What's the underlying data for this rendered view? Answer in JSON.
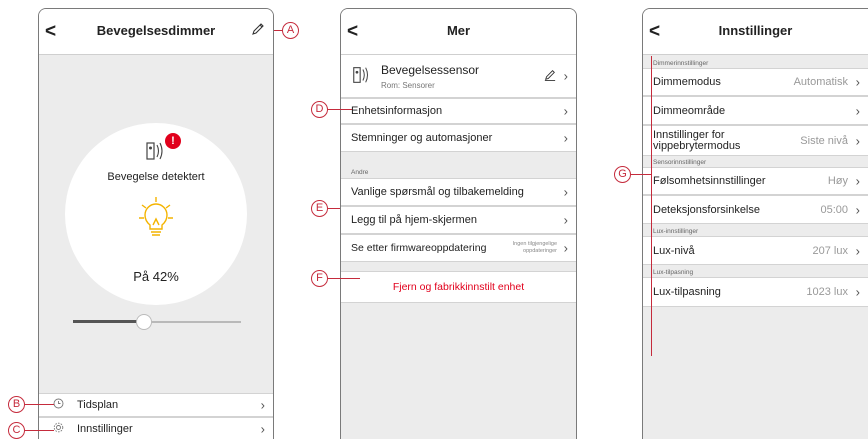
{
  "panel1": {
    "back": "<",
    "title": "Bevegelsesdimmer",
    "alert": "!",
    "detect_text": "Bevegelse detektert",
    "level_text": "På 42%",
    "level_fraction": 0.42,
    "rows": [
      {
        "label": "Tidsplan",
        "icon": "clock-icon"
      },
      {
        "label": "Innstillinger",
        "icon": "gear-icon"
      }
    ]
  },
  "panel2": {
    "back": "<",
    "title": "Mer",
    "device_name": "Bevegelsessensor",
    "device_room": "Rom: Sensorer",
    "rows": [
      {
        "label": "Enhetsinformasjon"
      },
      {
        "label": "Stemninger og automasjoner"
      }
    ],
    "section_label": "Andre",
    "rows2": [
      {
        "label": "Vanlige spørsmål og tilbakemelding"
      },
      {
        "label": "Legg til på hjem-skjermen"
      }
    ],
    "firmware_label": "Se etter firmwareoppdatering",
    "firmware_status_line1": "Ingen tilgjengelige",
    "firmware_status_line2": "oppdateringer",
    "remove_label": "Fjern og fabrikkinnstilt enhet"
  },
  "panel3": {
    "back": "<",
    "title": "Innstillinger",
    "sec_dimmer": "Dimmerinnstillinger",
    "dimmemodus_label": "Dimmemodus",
    "dimmemodus_value": "Automatisk",
    "dimmeomrade_label": "Dimmeområde",
    "vippe_label_1": "Innstillinger for",
    "vippe_label_2": "vippebrytermodus",
    "vippe_value": "Siste nivå",
    "sec_sensor": "Sensorinnstillinger",
    "folsomhet_label": "Følsomhetsinnstillinger",
    "folsomhet_value": "Høy",
    "forsinkelse_label": "Deteksjonsforsinkelse",
    "forsinkelse_value": "05:00",
    "sec_lux": "Lux-innstillinger",
    "luxniva_label": "Lux-nivå",
    "luxniva_value": "207 lux",
    "sec_luxtilp": "Lux-tilpasning",
    "luxtilp_label": "Lux-tilpasning",
    "luxtilp_value": "1023 lux"
  },
  "callouts": {
    "a": "A",
    "b": "B",
    "c": "C",
    "d": "D",
    "e": "E",
    "f": "F",
    "g": "G"
  },
  "colors": {
    "callout": "#c52b3c",
    "alert": "#e1001c",
    "remove_text": "#e1001c",
    "bulb": "#f4b400"
  }
}
